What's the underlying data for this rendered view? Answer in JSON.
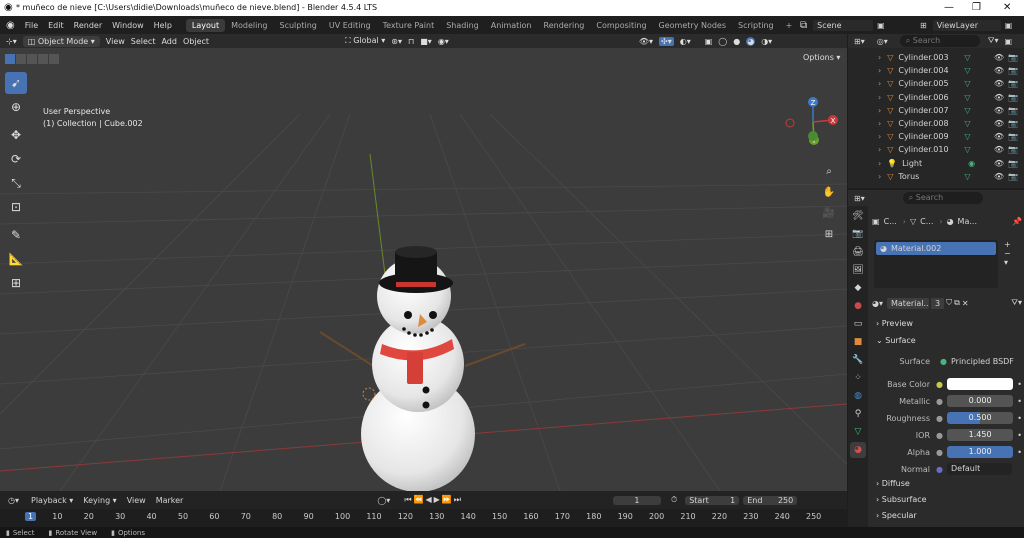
{
  "window": {
    "title": "* muñeco de nieve [C:\\Users\\didie\\Downloads\\muñeco de nieve.blend] - Blender 4.5.4 LTS",
    "controls": [
      "—",
      "❐",
      "✕"
    ]
  },
  "menu": {
    "items": [
      "File",
      "Edit",
      "Render",
      "Window",
      "Help"
    ],
    "workspaces": [
      "Layout",
      "Modeling",
      "Sculpting",
      "UV Editing",
      "Texture Paint",
      "Shading",
      "Animation",
      "Rendering",
      "Compositing",
      "Geometry Nodes",
      "Scripting"
    ],
    "add_tab": "+",
    "scene": "Scene",
    "view_layer": "ViewLayer"
  },
  "viewport_header": {
    "mode": "Object Mode",
    "menus": [
      "View",
      "Select",
      "Add",
      "Object"
    ],
    "orientation": "Global",
    "options": "Options"
  },
  "viewport": {
    "perspective": "User Perspective",
    "collection": "(1) Collection | Cube.002",
    "gizmo": {
      "x": "X",
      "y": "Y",
      "z": "Z"
    }
  },
  "outliner": {
    "search_placeholder": "Search",
    "items": [
      {
        "name": "Cylinder.003",
        "type": "mesh"
      },
      {
        "name": "Cylinder.004",
        "type": "mesh"
      },
      {
        "name": "Cylinder.005",
        "type": "mesh"
      },
      {
        "name": "Cylinder.006",
        "type": "mesh"
      },
      {
        "name": "Cylinder.007",
        "type": "mesh"
      },
      {
        "name": "Cylinder.008",
        "type": "mesh"
      },
      {
        "name": "Cylinder.009",
        "type": "mesh"
      },
      {
        "name": "Cylinder.010",
        "type": "mesh"
      },
      {
        "name": "Light",
        "type": "light"
      },
      {
        "name": "Torus",
        "type": "mesh"
      }
    ]
  },
  "properties": {
    "search_placeholder": "Search",
    "breadcrumb": [
      "C...",
      "C...",
      "Ma..."
    ],
    "material_slot": "Material.002",
    "material_name": "Material...",
    "users": "3",
    "panels": {
      "preview": "Preview",
      "surface": "Surface",
      "diffuse": "Diffuse",
      "subsurface": "Subsurface",
      "specular": "Specular"
    },
    "fields": {
      "surface_label": "Surface",
      "surface_value": "Principled BSDF",
      "base_color_label": "Base Color",
      "metallic_label": "Metallic",
      "metallic_value": "0.000",
      "roughness_label": "Roughness",
      "roughness_value": "0.500",
      "ior_label": "IOR",
      "ior_value": "1.450",
      "alpha_label": "Alpha",
      "alpha_value": "1.000",
      "normal_label": "Normal",
      "normal_value": "Default"
    },
    "roughness_fill": 0.5
  },
  "timeline": {
    "menus": [
      "Playback",
      "Keying",
      "View",
      "Marker"
    ],
    "current_frame": "1",
    "start_label": "Start",
    "start_value": "1",
    "end_label": "End",
    "end_value": "250",
    "ruler": [
      "1",
      "10",
      "20",
      "30",
      "40",
      "50",
      "60",
      "70",
      "80",
      "90",
      "100",
      "110",
      "120",
      "130",
      "140",
      "150",
      "160",
      "170",
      "180",
      "190",
      "200",
      "210",
      "220",
      "230",
      "240",
      "250"
    ]
  },
  "statusbar": {
    "items": [
      "Select",
      "Rotate View",
      "Options"
    ]
  },
  "colors": {
    "accent": "#4772b3",
    "mesh_icon": "#e08a3c",
    "mesh_data": "#49b37d",
    "snow": "#f2f2f2",
    "scarf": "#e0473f",
    "hat": "#111111"
  }
}
